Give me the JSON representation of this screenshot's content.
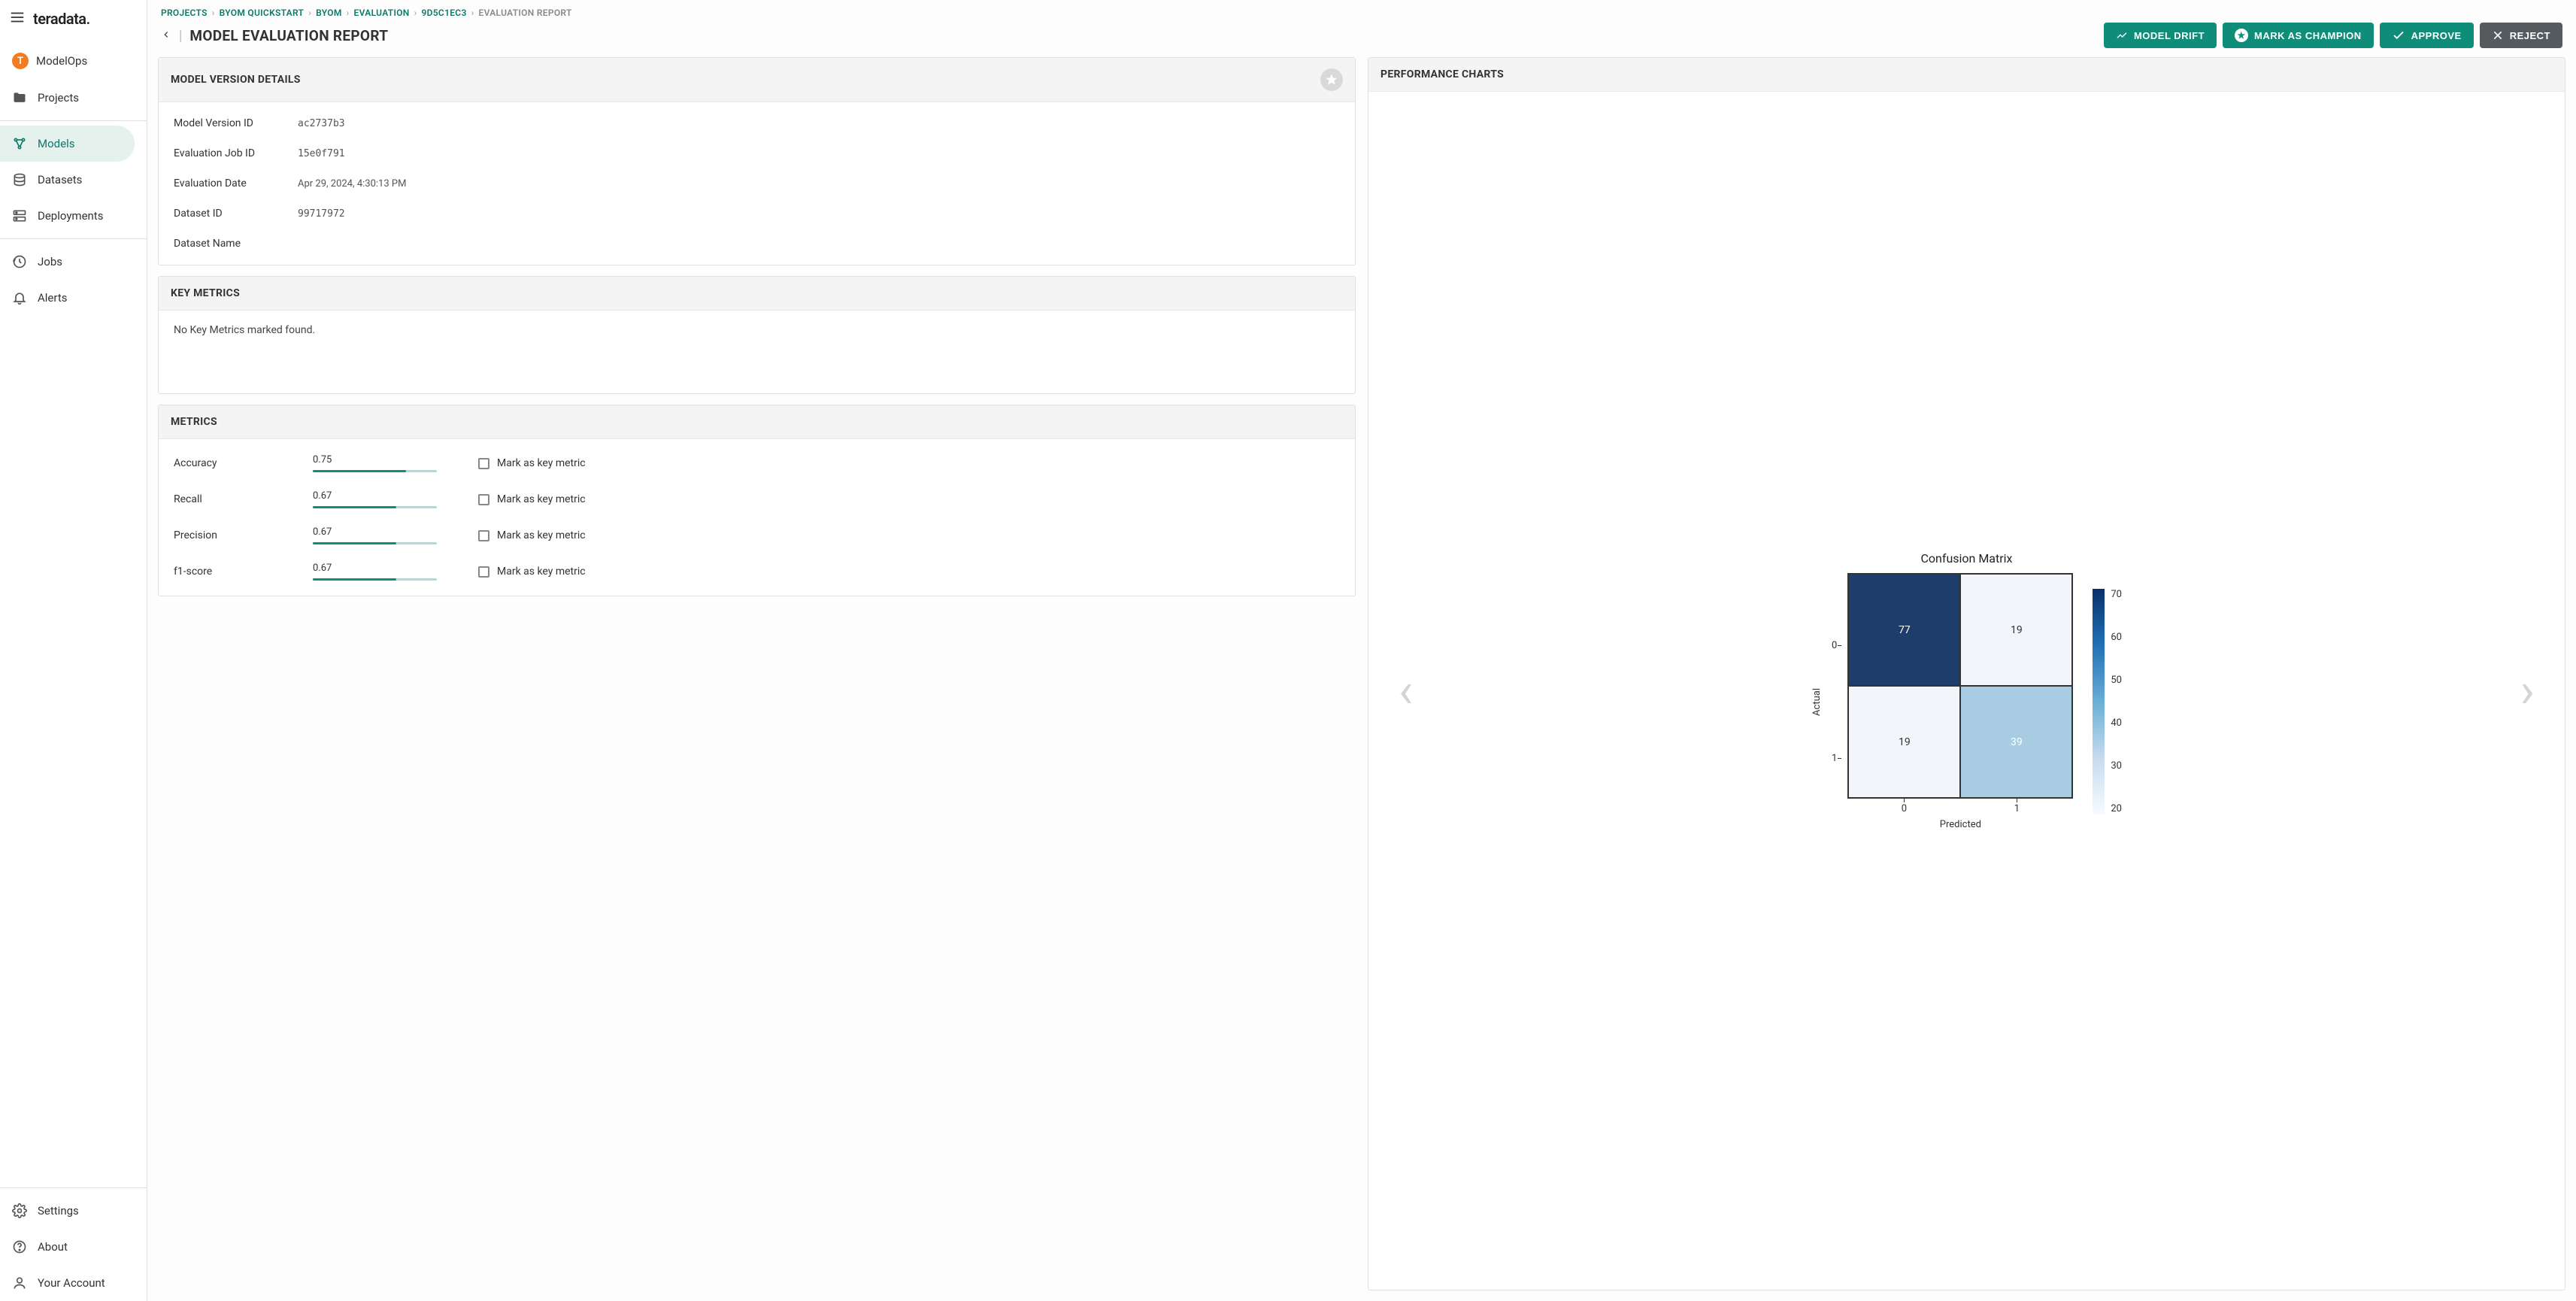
{
  "brand": "teradata.",
  "context": {
    "badge": "T",
    "label": "ModelOps"
  },
  "sidebar": {
    "items": [
      {
        "icon": "folder",
        "label": "Projects"
      },
      {
        "icon": "models",
        "label": "Models",
        "active": true
      },
      {
        "icon": "datasets",
        "label": "Datasets"
      },
      {
        "icon": "deployments",
        "label": "Deployments"
      },
      {
        "icon": "jobs",
        "label": "Jobs"
      },
      {
        "icon": "alerts",
        "label": "Alerts"
      }
    ],
    "footer": [
      {
        "icon": "settings",
        "label": "Settings"
      },
      {
        "icon": "about",
        "label": "About"
      },
      {
        "icon": "account",
        "label": "Your Account"
      }
    ]
  },
  "breadcrumb": [
    {
      "label": "PROJECTS",
      "link": true
    },
    {
      "label": "BYOM QUICKSTART",
      "link": true
    },
    {
      "label": "BYOM",
      "link": true
    },
    {
      "label": "EVALUATION",
      "link": true
    },
    {
      "label": "9D5C1EC3",
      "link": true
    },
    {
      "label": "EVALUATION REPORT",
      "link": false
    }
  ],
  "page_title": "MODEL EVALUATION REPORT",
  "actions": {
    "model_drift": "MODEL DRIFT",
    "mark_champion": "MARK AS CHAMPION",
    "approve": "APPROVE",
    "reject": "REJECT"
  },
  "cards": {
    "details_title": "MODEL VERSION DETAILS",
    "key_metrics_title": "KEY METRICS",
    "metrics_title": "METRICS",
    "performance_title": "PERFORMANCE CHARTS"
  },
  "details": [
    {
      "label": "Model Version ID",
      "value": "ac2737b3",
      "mono": true
    },
    {
      "label": "Evaluation Job ID",
      "value": "15e0f791",
      "mono": true
    },
    {
      "label": "Evaluation Date",
      "value": "Apr 29, 2024, 4:30:13 PM",
      "mono": false
    },
    {
      "label": "Dataset ID",
      "value": "99717972",
      "mono": true
    },
    {
      "label": "Dataset Name",
      "value": "",
      "mono": false
    }
  ],
  "key_metrics_empty": "No Key Metrics marked found.",
  "metrics": [
    {
      "name": "Accuracy",
      "value": 0.75
    },
    {
      "name": "Recall",
      "value": 0.67
    },
    {
      "name": "Precision",
      "value": 0.67
    },
    {
      "name": "f1-score",
      "value": 0.67
    }
  ],
  "mark_key_label": "Mark as key metric",
  "chart_data": {
    "type": "heatmap",
    "title": "Confusion Matrix",
    "xlabel": "Predicted",
    "ylabel": "Actual",
    "x_categories": [
      "0",
      "1"
    ],
    "y_categories": [
      "0",
      "1"
    ],
    "values": [
      [
        77,
        19
      ],
      [
        19,
        39
      ]
    ],
    "cell_colors": [
      [
        "#1f3d6b",
        "#f2f6fb"
      ],
      [
        "#f2f6fb",
        "#a8cce2"
      ]
    ],
    "cell_text_colors": [
      [
        "#ffffff",
        "#333333"
      ],
      [
        "#333333",
        "#ffffff"
      ]
    ],
    "colorbar": {
      "min": 20,
      "max": 70,
      "ticks": [
        70,
        60,
        50,
        40,
        30,
        20
      ]
    }
  }
}
